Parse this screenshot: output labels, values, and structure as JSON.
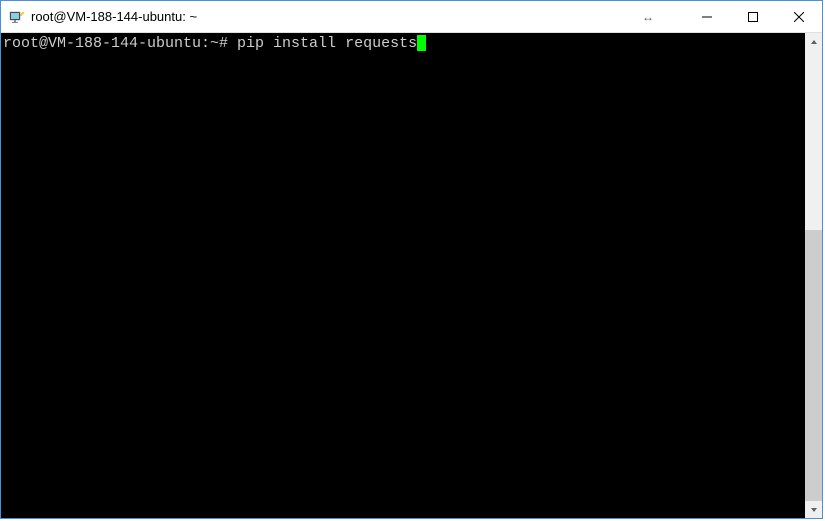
{
  "window": {
    "title": "root@VM-188-144-ubuntu: ~"
  },
  "terminal": {
    "prompt": "root@VM-188-144-ubuntu:~# ",
    "command": "pip install requests"
  }
}
